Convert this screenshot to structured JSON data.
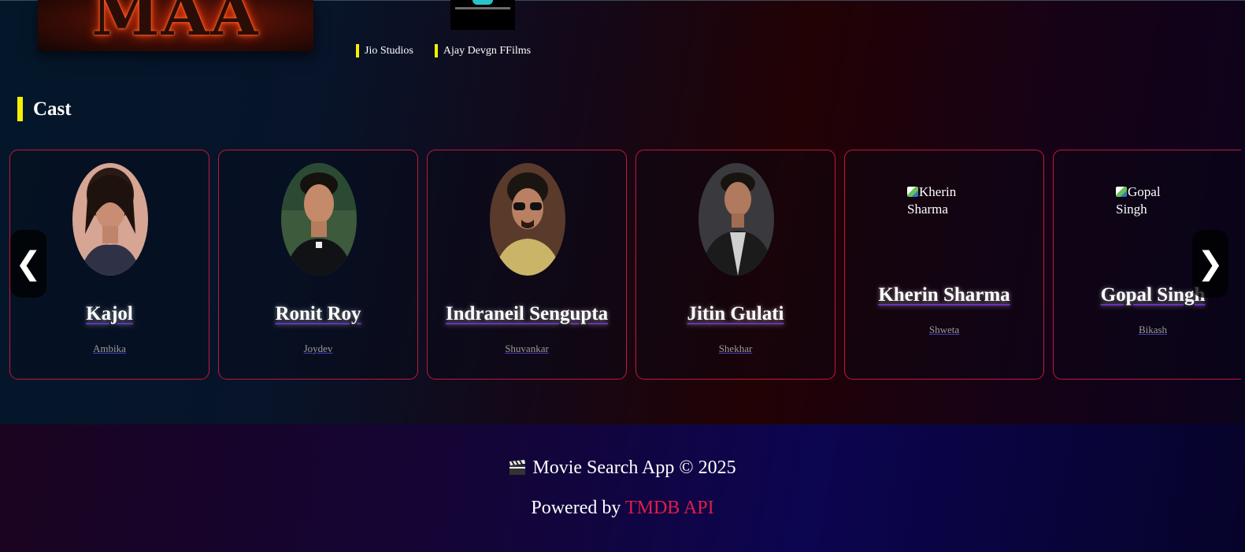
{
  "movie": {
    "poster_title": "MAA",
    "production_companies": [
      "Jio Studios",
      "Ajay Devgn FFilms"
    ]
  },
  "cast_section": {
    "title": "Cast",
    "prev_arrow": "❮",
    "next_arrow": "❯",
    "members": [
      {
        "name": "Kajol",
        "character": "Ambika",
        "photo": "portrait"
      },
      {
        "name": "Ronit Roy",
        "character": "Joydev",
        "photo": "portrait"
      },
      {
        "name": "Indraneil Sengupta",
        "character": "Shuvankar",
        "photo": "portrait"
      },
      {
        "name": "Jitin Gulati",
        "character": "Shekhar",
        "photo": "portrait"
      },
      {
        "name": "Kherin Sharma",
        "character": "Shweta",
        "photo": "broken",
        "photo_alt": "Kherin Sharma"
      },
      {
        "name": "Gopal Singh",
        "character": "Bikash",
        "photo": "broken",
        "photo_alt": "Gopal Singh"
      }
    ]
  },
  "footer": {
    "line1": "Movie Search App © 2025",
    "powered_prefix": "Powered by",
    "powered_link": "TMDB API",
    "accent_color": "#e11d48"
  },
  "colors": {
    "card_border": "#c2183a",
    "section_marker": "#f5f000"
  }
}
